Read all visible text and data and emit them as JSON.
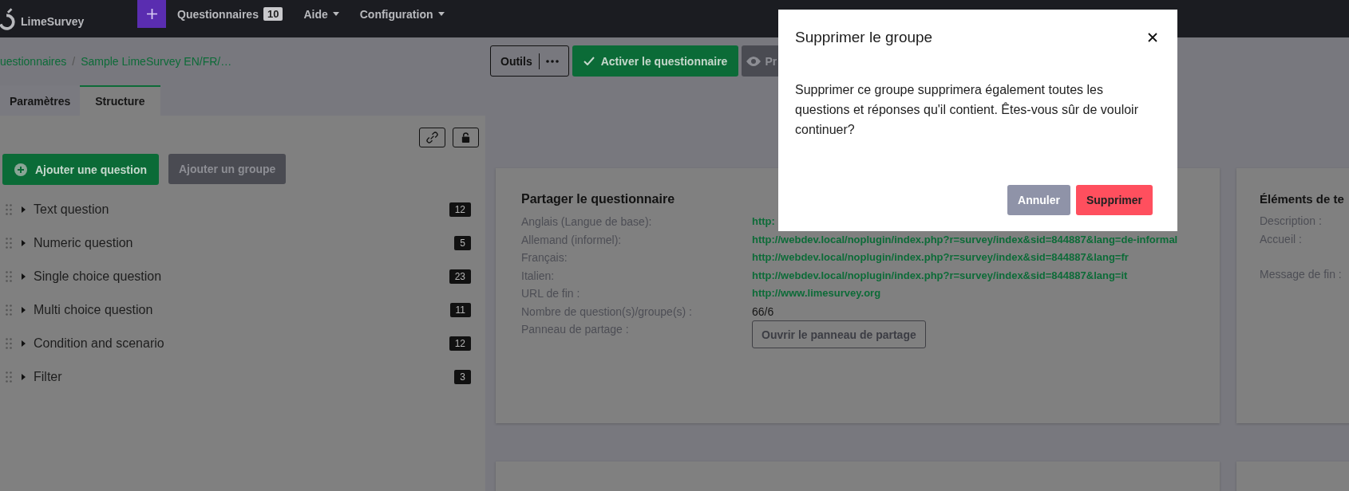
{
  "navbar": {
    "brand": "LimeSurvey",
    "menu": [
      {
        "label": "Questionnaires",
        "kind": "badge",
        "badge": "10"
      },
      {
        "label": "Aide",
        "kind": "dropdown"
      },
      {
        "label": "Configuration",
        "kind": "dropdown"
      }
    ]
  },
  "breadcrumb": [
    {
      "label": "uestionnaires",
      "kind": "link"
    },
    {
      "label": "/",
      "kind": "separator"
    },
    {
      "label": "Sample LimeSurvey EN/FR/…",
      "kind": "link"
    }
  ],
  "toolbar": [
    {
      "label": "Outils",
      "kind": "tools"
    },
    {
      "label": "Activer le questionnaire",
      "kind": "activate"
    },
    {
      "label": "Pr",
      "kind": "preview"
    }
  ],
  "tabs": [
    {
      "label": "Paramètres",
      "selected": false
    },
    {
      "label": "Structure",
      "selected": true
    }
  ],
  "structure": {
    "add_question": "Ajouter une question",
    "add_group": {
      "label": "Ajouter un groupe",
      "disabled": true
    },
    "groups": [
      {
        "name": "Text question",
        "count": "12",
        "expanded": false
      },
      {
        "name": "Numeric question",
        "count": "5",
        "expanded": false
      },
      {
        "name": "Single choice question",
        "count": "23",
        "expanded": false
      },
      {
        "name": "Multi choice question",
        "count": "11",
        "expanded": false
      },
      {
        "name": "Condition and scenario",
        "count": "12",
        "expanded": false
      },
      {
        "name": "Filter",
        "count": "3",
        "expanded": false
      }
    ]
  },
  "share_card": {
    "title": "Partager le questionnaire",
    "rows": [
      {
        "label": "Anglais (Langue de base):",
        "kind": "link",
        "value": "http:"
      },
      {
        "label": "Allemand (informel):",
        "kind": "link",
        "value": "http://webdev.local/noplugin/index.php?r=survey/index&sid=844887&lang=de-informal"
      },
      {
        "label": "Français:",
        "kind": "link",
        "value": "http://webdev.local/noplugin/index.php?r=survey/index&sid=844887&lang=fr"
      },
      {
        "label": "Italien:",
        "kind": "link",
        "value": "http://webdev.local/noplugin/index.php?r=survey/index&sid=844887&lang=it"
      },
      {
        "label": "URL de fin :",
        "kind": "link",
        "value": "http://www.limesurvey.org"
      },
      {
        "label": "Nombre de question(s)/groupe(s) :",
        "kind": "text",
        "value": "66/6"
      },
      {
        "label": "Panneau de partage :",
        "kind": "button",
        "value": "Ouvrir le panneau de partage"
      }
    ]
  },
  "text_card": {
    "title": "Éléments de te",
    "rows": [
      "Description :",
      "Accueil :",
      "Message de fin :"
    ]
  },
  "dialog": {
    "title": "Supprimer le groupe",
    "message": "Supprimer ce groupe supprimera également toutes les questions et réponses qu'il contient. Êtes-vous sûr de vouloir continuer?",
    "buttons": [
      {
        "label": "Annuler",
        "kind": "secondary"
      },
      {
        "label": "Supprimer",
        "kind": "danger"
      }
    ]
  }
}
